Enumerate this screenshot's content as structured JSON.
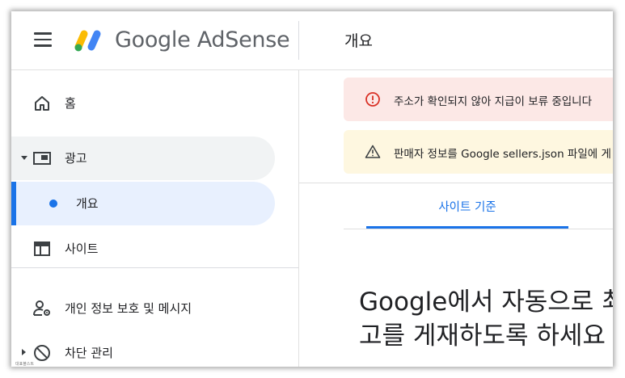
{
  "app": {
    "brand": "Google AdSense",
    "page_title": "개요"
  },
  "sidebar": {
    "items": [
      {
        "label": "홈",
        "icon": "home-icon"
      },
      {
        "label": "광고",
        "icon": "ads-icon",
        "expanded": true
      },
      {
        "label": "개요",
        "active": true
      },
      {
        "label": "사이트",
        "icon": "sites-icon"
      },
      {
        "label": "개인 정보 보호 및 메시지",
        "icon": "privacy-icon"
      },
      {
        "label": "차단 관리",
        "icon": "block-icon",
        "expanded": false
      }
    ]
  },
  "alerts": [
    {
      "type": "error",
      "icon": "error-icon",
      "text": "주소가 확인되지 않아 지급이 보류 중입니다"
    },
    {
      "type": "warning",
      "icon": "warning-icon",
      "text": "판매자 정보를 Google sellers.json 파일에 게"
    }
  ],
  "tabs": [
    {
      "label": "사이트 기준",
      "selected": true
    }
  ],
  "content": {
    "headline_line1": "Google에서 자동으로 최",
    "headline_line2": "고를 게재하도록 하세요"
  },
  "watermark": "대표블스트",
  "colors": {
    "accent": "#1a73e8",
    "active_bg": "#e8f0fe",
    "error_bg": "#fce8e6",
    "error": "#d93025",
    "warning_bg": "#fef7e0"
  }
}
